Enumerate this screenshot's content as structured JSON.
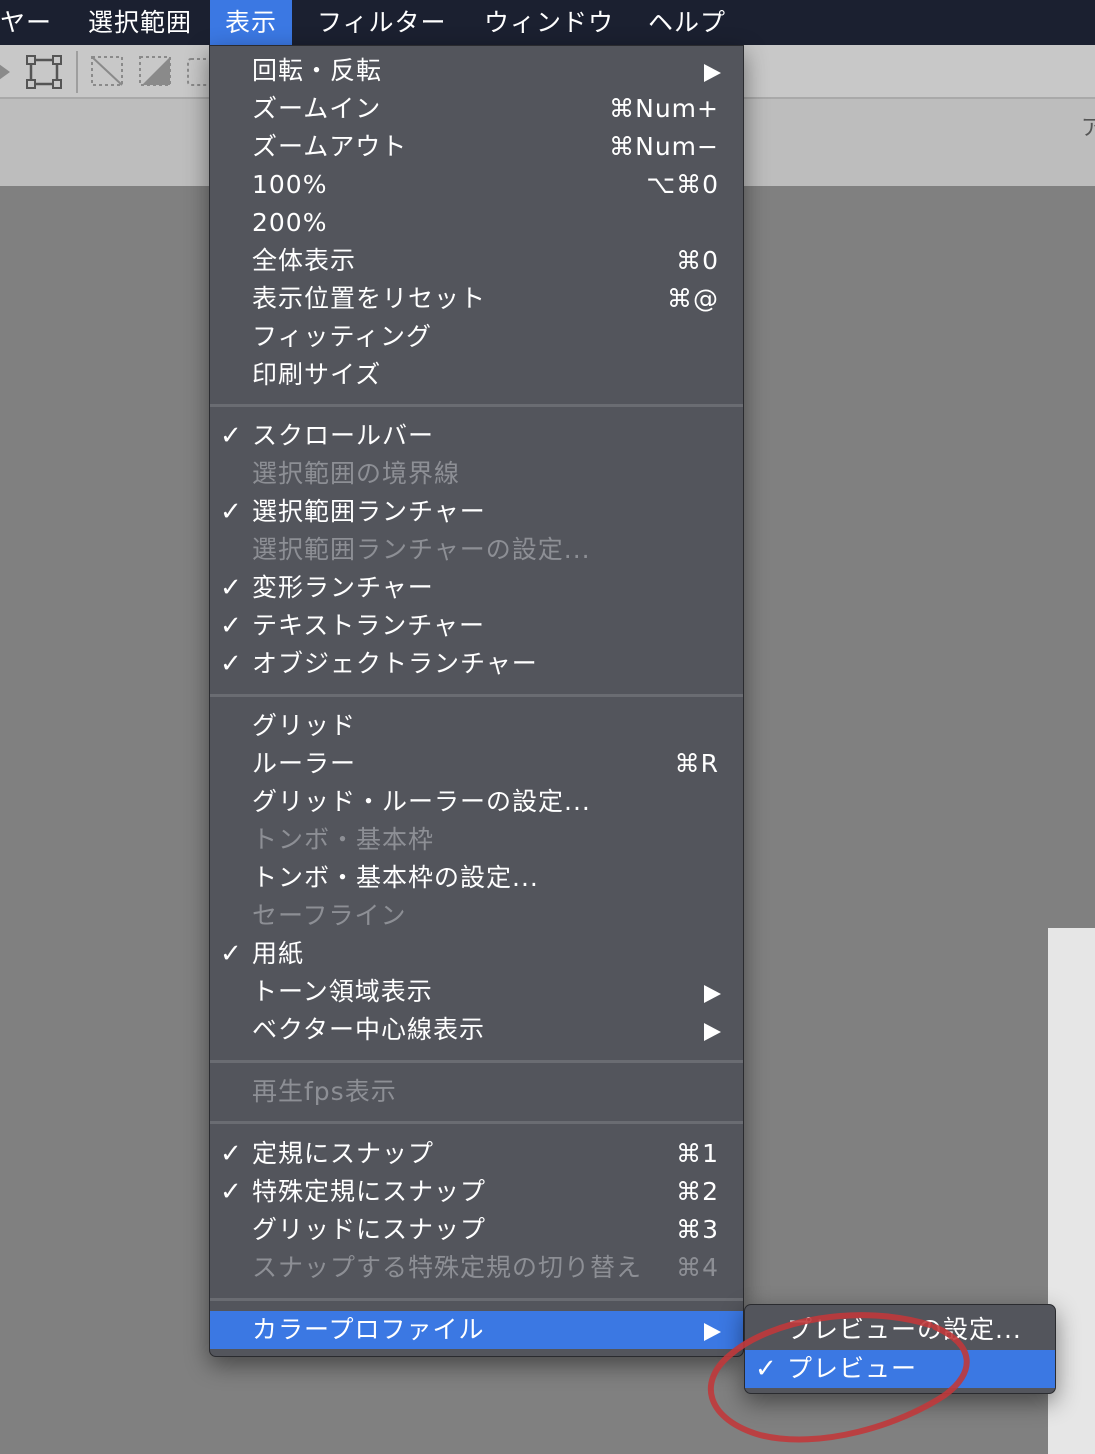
{
  "menubar": {
    "items": [
      {
        "label": "ヤー"
      },
      {
        "label": "選択範囲"
      },
      {
        "label": "表示"
      },
      {
        "label": "フィルター"
      },
      {
        "label": "ウィンドウ"
      },
      {
        "label": "ヘルプ"
      }
    ]
  },
  "subbar": {
    "text": "ア"
  },
  "menu": {
    "items": [
      {
        "label": "回転・反転",
        "shortcut": ""
      },
      {
        "label": "ズームイン",
        "shortcut": "⌘Num+"
      },
      {
        "label": "ズームアウト",
        "shortcut": "⌘Num−"
      },
      {
        "label": "100%",
        "shortcut": "⌥⌘0"
      },
      {
        "label": "200%",
        "shortcut": ""
      },
      {
        "label": "全体表示",
        "shortcut": "⌘0"
      },
      {
        "label": "表示位置をリセット",
        "shortcut": "⌘@"
      },
      {
        "label": "フィッティング",
        "shortcut": ""
      },
      {
        "label": "印刷サイズ",
        "shortcut": ""
      },
      {
        "label": "スクロールバー",
        "shortcut": "",
        "check": "✓"
      },
      {
        "label": "選択範囲の境界線",
        "shortcut": ""
      },
      {
        "label": "選択範囲ランチャー",
        "shortcut": "",
        "check": "✓"
      },
      {
        "label": "選択範囲ランチャーの設定...",
        "shortcut": ""
      },
      {
        "label": "変形ランチャー",
        "shortcut": "",
        "check": "✓"
      },
      {
        "label": "テキストランチャー",
        "shortcut": "",
        "check": "✓"
      },
      {
        "label": "オブジェクトランチャー",
        "shortcut": "",
        "check": "✓"
      },
      {
        "label": "グリッド",
        "shortcut": ""
      },
      {
        "label": "ルーラー",
        "shortcut": "⌘R"
      },
      {
        "label": "グリッド・ルーラーの設定...",
        "shortcut": ""
      },
      {
        "label": "トンボ・基本枠",
        "shortcut": ""
      },
      {
        "label": "トンボ・基本枠の設定...",
        "shortcut": ""
      },
      {
        "label": "セーフライン",
        "shortcut": ""
      },
      {
        "label": "用紙",
        "shortcut": "",
        "check": "✓"
      },
      {
        "label": "トーン領域表示",
        "shortcut": ""
      },
      {
        "label": "ベクター中心線表示",
        "shortcut": ""
      },
      {
        "label": "再生fps表示",
        "shortcut": ""
      },
      {
        "label": "定規にスナップ",
        "shortcut": "⌘1",
        "check": "✓"
      },
      {
        "label": "特殊定規にスナップ",
        "shortcut": "⌘2",
        "check": "✓"
      },
      {
        "label": "グリッドにスナップ",
        "shortcut": "⌘3"
      },
      {
        "label": "スナップする特殊定規の切り替え",
        "shortcut": "⌘4"
      },
      {
        "label": "カラープロファイル",
        "shortcut": ""
      }
    ]
  },
  "submenu": {
    "items": [
      {
        "label": "プレビューの設定...",
        "check": ""
      },
      {
        "label": "プレビュー",
        "check": "✓"
      }
    ]
  },
  "colors": {
    "menubar_bg": "#1b2030",
    "highlight": "#3b78e3",
    "menu_bg": "#53555c",
    "disabled_text": "#8d8f95",
    "annotation": "#c0393b"
  }
}
